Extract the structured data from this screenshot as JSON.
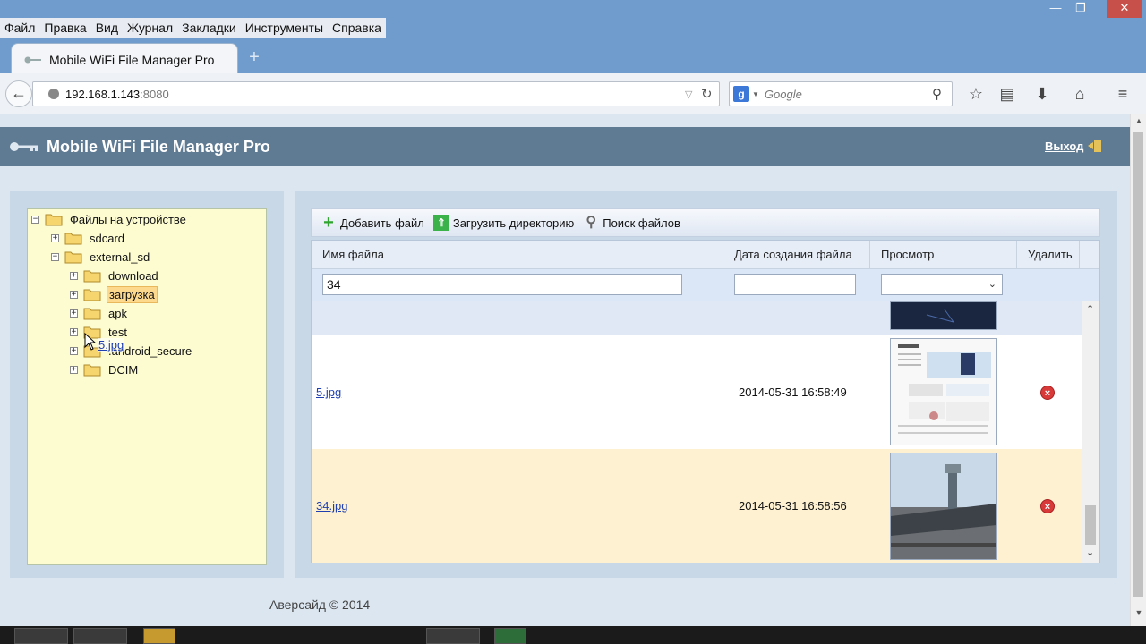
{
  "menu": [
    "Файл",
    "Правка",
    "Вид",
    "Журнал",
    "Закладки",
    "Инструменты",
    "Справка"
  ],
  "window_controls": {
    "minimize": "—",
    "maximize": "❐",
    "close": "✕"
  },
  "tab": {
    "title": "Mobile WiFi File Manager Pro",
    "new_tab": "+"
  },
  "nav": {
    "url_host": "192.168.1.143",
    "url_port": ":8080",
    "search_placeholder": "Google"
  },
  "app": {
    "title": "Mobile WiFi File Manager Pro",
    "logout": "Выход"
  },
  "tree": {
    "root": "Файлы на устройстве",
    "items": [
      "sdcard",
      "external_sd",
      "download",
      "загрузка",
      "apk",
      "test",
      ".android_secure",
      "DCIM"
    ],
    "drag_label": "5.jpg"
  },
  "toolbar": {
    "add_file": "Добавить файл",
    "upload_dir": "Загрузить директорию",
    "search_files": "Поиск файлов"
  },
  "grid": {
    "headers": [
      "Имя файла",
      "Дата создания файла",
      "Просмотр",
      "Удалить"
    ],
    "filter_name": "34",
    "rows": [
      {
        "name": "5.jpg",
        "date": "2014-05-31 16:58:49"
      },
      {
        "name": "34.jpg",
        "date": "2014-05-31 16:58:56"
      }
    ]
  },
  "footer": "Аверсайд © 2014",
  "colors": {
    "header": "#5f7a93",
    "tree_bg": "#fdfcd1",
    "selected_row": "#fdf1d2",
    "link": "#1f3fb0"
  }
}
